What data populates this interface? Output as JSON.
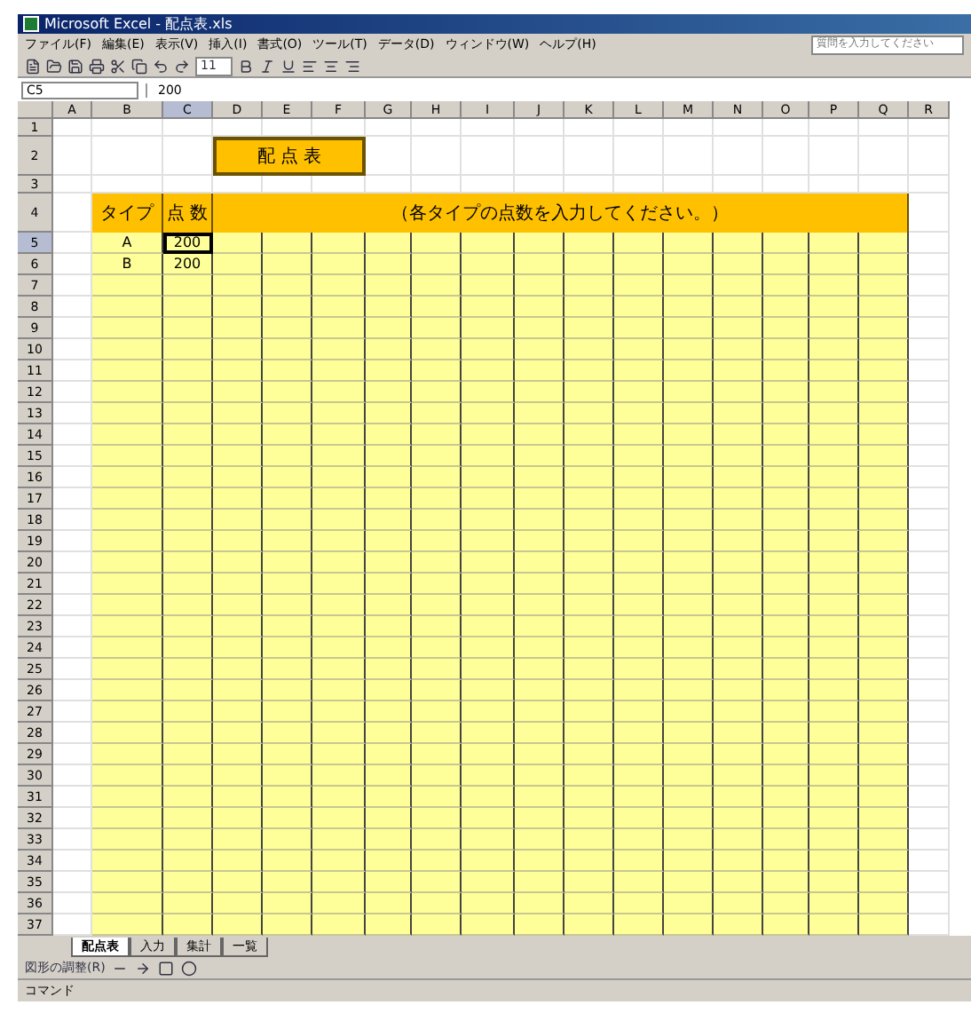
{
  "window": {
    "title": "Microsoft Excel - 配点表.xls"
  },
  "menu": [
    "ファイル(F)",
    "編集(E)",
    "表示(V)",
    "挿入(I)",
    "書式(O)",
    "ツール(T)",
    "データ(D)",
    "ウィンドウ(W)",
    "ヘルプ(H)"
  ],
  "help_box": {
    "placeholder": "質問を入力してください"
  },
  "toolbar": {
    "font_size": "11"
  },
  "formula_bar": {
    "name_box": "C5",
    "value": "200"
  },
  "sheet": {
    "columns": [
      {
        "label": "A",
        "selected": false
      },
      {
        "label": "B",
        "selected": false
      },
      {
        "label": "C",
        "selected": true
      },
      {
        "label": "D",
        "selected": false
      },
      {
        "label": "E",
        "selected": false
      },
      {
        "label": "F",
        "selected": false
      },
      {
        "label": "G",
        "selected": false
      },
      {
        "label": "H",
        "selected": false
      },
      {
        "label": "I",
        "selected": false
      },
      {
        "label": "J",
        "selected": false
      },
      {
        "label": "K",
        "selected": false
      },
      {
        "label": "L",
        "selected": false
      },
      {
        "label": "M",
        "selected": false
      },
      {
        "label": "N",
        "selected": false
      },
      {
        "label": "O",
        "selected": false
      },
      {
        "label": "P",
        "selected": false
      },
      {
        "label": "Q",
        "selected": false
      },
      {
        "label": "R",
        "selected": false
      }
    ],
    "rows": [
      {
        "label": "1",
        "kind": "blank",
        "selected": false
      },
      {
        "label": "2",
        "kind": "title",
        "selected": false,
        "title": "配 点 表"
      },
      {
        "label": "3",
        "kind": "blank",
        "selected": false
      },
      {
        "label": "4",
        "kind": "header",
        "selected": false,
        "cells": [
          "タイプ",
          "点 数",
          "（各タイプの点数を入力してください。）"
        ]
      },
      {
        "label": "5",
        "kind": "data",
        "selected": true,
        "type": "A",
        "value": "200"
      },
      {
        "label": "6",
        "kind": "data",
        "selected": false,
        "type": "B",
        "value": "200"
      },
      {
        "label": "7",
        "kind": "data",
        "selected": false
      },
      {
        "label": "8",
        "kind": "data",
        "selected": false
      },
      {
        "label": "9",
        "kind": "data",
        "selected": false
      },
      {
        "label": "10",
        "kind": "data",
        "selected": false
      },
      {
        "label": "11",
        "kind": "data",
        "selected": false
      },
      {
        "label": "12",
        "kind": "data",
        "selected": false
      },
      {
        "label": "13",
        "kind": "data",
        "selected": false
      },
      {
        "label": "14",
        "kind": "data",
        "selected": false
      },
      {
        "label": "15",
        "kind": "data",
        "selected": false
      },
      {
        "label": "16",
        "kind": "data",
        "selected": false
      },
      {
        "label": "17",
        "kind": "data",
        "selected": false
      },
      {
        "label": "18",
        "kind": "data",
        "selected": false
      },
      {
        "label": "19",
        "kind": "data",
        "selected": false
      },
      {
        "label": "20",
        "kind": "data",
        "selected": false
      },
      {
        "label": "21",
        "kind": "data",
        "selected": false
      },
      {
        "label": "22",
        "kind": "data",
        "selected": false
      },
      {
        "label": "23",
        "kind": "data",
        "selected": false
      },
      {
        "label": "24",
        "kind": "data",
        "selected": false
      },
      {
        "label": "25",
        "kind": "data",
        "selected": false
      },
      {
        "label": "26",
        "kind": "data",
        "selected": false
      },
      {
        "label": "27",
        "kind": "data",
        "selected": false
      },
      {
        "label": "28",
        "kind": "data",
        "selected": false
      },
      {
        "label": "29",
        "kind": "data",
        "selected": false
      },
      {
        "label": "30",
        "kind": "data",
        "selected": false
      },
      {
        "label": "31",
        "kind": "data",
        "selected": false
      },
      {
        "label": "32",
        "kind": "data",
        "selected": false
      },
      {
        "label": "33",
        "kind": "data",
        "selected": false
      },
      {
        "label": "34",
        "kind": "data",
        "selected": false
      },
      {
        "label": "35",
        "kind": "data",
        "selected": false
      },
      {
        "label": "36",
        "kind": "data",
        "selected": false
      },
      {
        "label": "37",
        "kind": "data",
        "selected": false
      }
    ]
  },
  "sheet_tabs": [
    {
      "label": "配点表",
      "selected": true
    },
    {
      "label": "入力",
      "selected": false
    },
    {
      "label": "集計",
      "selected": false
    },
    {
      "label": "一覧",
      "selected": false
    }
  ],
  "drawing_toolbar": {
    "label": "図形の調整(R)"
  },
  "status_bar": {
    "text": "コマンド"
  }
}
